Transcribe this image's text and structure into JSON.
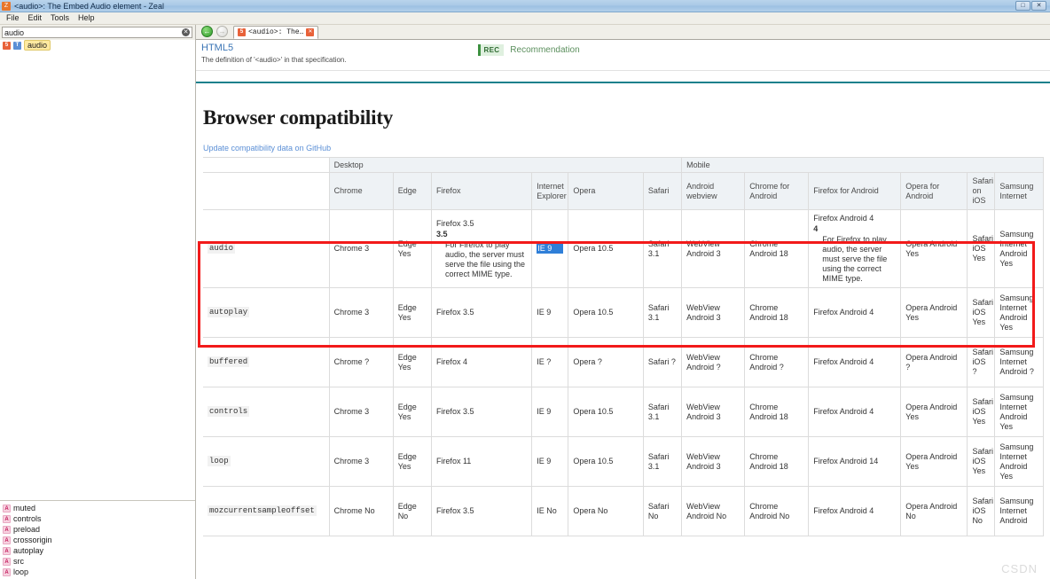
{
  "window": {
    "title": "<audio>: The Embed Audio element - Zeal",
    "app_icon": "zeal-icon",
    "buttons": {
      "restore": "restore-window",
      "close": "close-window"
    }
  },
  "menubar": {
    "items": [
      "File",
      "Edit",
      "Tools",
      "Help"
    ]
  },
  "sidebar": {
    "search": {
      "value": "audio",
      "placeholder": "Search",
      "clear_icon": "clear-icon"
    },
    "tree": [
      {
        "badges": [
          "HTML5",
          "T"
        ],
        "label": "audio",
        "selected": true
      }
    ],
    "attributes": [
      {
        "badge": "A",
        "label": "muted"
      },
      {
        "badge": "A",
        "label": "controls"
      },
      {
        "badge": "A",
        "label": "preload"
      },
      {
        "badge": "A",
        "label": "crossorigin"
      },
      {
        "badge": "A",
        "label": "autoplay"
      },
      {
        "badge": "A",
        "label": "src"
      },
      {
        "badge": "A",
        "label": "loop"
      }
    ]
  },
  "toolbar": {
    "back_icon": "back-arrow-icon",
    "forward_icon": "forward-arrow-icon",
    "tab": {
      "icon": "html5-icon",
      "title": "<audio>: The…",
      "close_icon": "close-tab-icon"
    }
  },
  "spec": {
    "name": "HTML5",
    "description": "The definition of '<audio>' in that specification.",
    "status_badge": "REC",
    "status_label": "Recommendation"
  },
  "compat": {
    "heading": "Browser compatibility",
    "update_link": "Update compatibility data on GitHub",
    "platforms": [
      {
        "label": "Desktop",
        "span": 6
      },
      {
        "label": "Mobile",
        "span": 7
      }
    ],
    "browsers": [
      "Chrome",
      "Edge",
      "Firefox",
      "Internet Explorer",
      "Opera",
      "Safari",
      "Android webview",
      "Chrome for Android",
      "Firefox for Android",
      "Opera for Android",
      "Safari on iOS",
      "Samsung Internet"
    ],
    "rows": [
      {
        "feature": "audio",
        "highlighted": true,
        "cells": [
          {
            "text": "Chrome 3"
          },
          {
            "text": "Edge Yes"
          },
          {
            "text": "Firefox 3.5",
            "note_version": "3.5",
            "note_text": "For Firefox to play audio, the server must serve the file using the correct MIME type."
          },
          {
            "text": "IE 9",
            "selected": true
          },
          {
            "text": "Opera 10.5"
          },
          {
            "text": "Safari 3.1"
          },
          {
            "text": "WebView Android 3"
          },
          {
            "text": "Chrome Android 18"
          },
          {
            "text": "Firefox Android 4",
            "note_version": "4",
            "note_text": "For Firefox to play audio, the server must serve the file using the correct MIME type."
          },
          {
            "text": "Opera Android Yes"
          },
          {
            "text": "Safari iOS Yes"
          },
          {
            "text": "Samsung Internet Android Yes"
          }
        ]
      },
      {
        "feature": "autoplay",
        "highlighted": false,
        "cells": [
          {
            "text": "Chrome 3"
          },
          {
            "text": "Edge Yes"
          },
          {
            "text": "Firefox 3.5"
          },
          {
            "text": "IE 9"
          },
          {
            "text": "Opera 10.5"
          },
          {
            "text": "Safari 3.1"
          },
          {
            "text": "WebView Android 3"
          },
          {
            "text": "Chrome Android 18"
          },
          {
            "text": "Firefox Android 4"
          },
          {
            "text": "Opera Android Yes"
          },
          {
            "text": "Safari iOS Yes"
          },
          {
            "text": "Samsung Internet Android Yes"
          }
        ]
      },
      {
        "feature": "buffered",
        "highlighted": false,
        "cells": [
          {
            "text": "Chrome ?"
          },
          {
            "text": "Edge Yes"
          },
          {
            "text": "Firefox 4"
          },
          {
            "text": "IE ?"
          },
          {
            "text": "Opera ?"
          },
          {
            "text": "Safari ?"
          },
          {
            "text": "WebView Android ?"
          },
          {
            "text": "Chrome Android ?"
          },
          {
            "text": "Firefox Android 4"
          },
          {
            "text": "Opera Android ?"
          },
          {
            "text": "Safari iOS ?"
          },
          {
            "text": "Samsung Internet Android ?"
          }
        ]
      },
      {
        "feature": "controls",
        "highlighted": false,
        "cells": [
          {
            "text": "Chrome 3"
          },
          {
            "text": "Edge Yes"
          },
          {
            "text": "Firefox 3.5"
          },
          {
            "text": "IE 9"
          },
          {
            "text": "Opera 10.5"
          },
          {
            "text": "Safari 3.1"
          },
          {
            "text": "WebView Android 3"
          },
          {
            "text": "Chrome Android 18"
          },
          {
            "text": "Firefox Android 4"
          },
          {
            "text": "Opera Android Yes"
          },
          {
            "text": "Safari iOS Yes"
          },
          {
            "text": "Samsung Internet Android Yes"
          }
        ]
      },
      {
        "feature": "loop",
        "highlighted": false,
        "cells": [
          {
            "text": "Chrome 3"
          },
          {
            "text": "Edge Yes"
          },
          {
            "text": "Firefox 11"
          },
          {
            "text": "IE 9"
          },
          {
            "text": "Opera 10.5"
          },
          {
            "text": "Safari 3.1"
          },
          {
            "text": "WebView Android 3"
          },
          {
            "text": "Chrome Android 18"
          },
          {
            "text": "Firefox Android 14"
          },
          {
            "text": "Opera Android Yes"
          },
          {
            "text": "Safari iOS Yes"
          },
          {
            "text": "Samsung Internet Android Yes"
          }
        ]
      },
      {
        "feature": "mozcurrentsampleoffset",
        "highlighted": false,
        "cells": [
          {
            "text": "Chrome No"
          },
          {
            "text": "Edge No"
          },
          {
            "text": "Firefox 3.5"
          },
          {
            "text": "IE No"
          },
          {
            "text": "Opera No"
          },
          {
            "text": "Safari No"
          },
          {
            "text": "WebView Android No"
          },
          {
            "text": "Chrome Android No"
          },
          {
            "text": "Firefox Android 4"
          },
          {
            "text": "Opera Android No"
          },
          {
            "text": "Safari iOS No"
          },
          {
            "text": "Samsung Internet Android"
          }
        ]
      }
    ]
  },
  "watermark": "CSDN",
  "colors": {
    "accent": "#19808c",
    "highlight": "#f21a1a",
    "selection": "#2f7fd8",
    "link": "#5b8fd6",
    "rec_green": "#3d9140"
  }
}
